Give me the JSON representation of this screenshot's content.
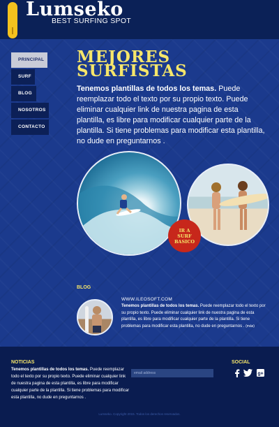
{
  "header": {
    "logo_title": "Lumseko",
    "logo_subtitle": "BEST SURFING SPOT"
  },
  "nav": {
    "items": [
      {
        "label": "PRINCIPAL",
        "active": true
      },
      {
        "label": "SURF"
      },
      {
        "label": "BLOG"
      },
      {
        "label": "NOSOTROS"
      },
      {
        "label": "CONTACTO"
      }
    ]
  },
  "hero": {
    "headline_line1": "MEJORES",
    "headline_line2": "SURFISTAS",
    "intro_bold": "Tenemos plantillas de todos los temas.",
    "intro_rest": " Puede reemplazar todo el texto por su propio texto. Puede eliminar cualquier link de nuestra pagina de esta plantilla, es libre para modificar cualquier parte de la plantilla. Si tiene problemas para modificar esta plantilla, no dude en preguntarnos ."
  },
  "badge": {
    "line1": "IR A",
    "line2": "SURF",
    "line3": "BASICO"
  },
  "blog": {
    "title": "BLOG",
    "url": "WWW.ILEOSOFT.COM",
    "text_bold": "Tenemos plantillas de todos los temas.",
    "text_rest": " Puede reemplazar todo el texto por su propio texto. Puede eliminar cualquier link de nuestra pagina de esta plantilla, es libre para modificar cualquier parte de la plantilla. Si tiene problemas para modificar esta plantilla, no dude en preguntarnos .",
    "more_label": "(más)"
  },
  "footer": {
    "noticias_title": "NOTICIAS",
    "noticias_bold": "Tenemos plantillas de todos los temas.",
    "noticias_rest": " Puede reemplazar todo el texto por su propio texto. Puede eliminar cualquier link de nuestra pagina de esta plantilla, es libre para modificar cualquier parte de la plantilla. Si tiene problemas para modificar esta plantilla, no dude en preguntarnos .",
    "email_placeholder": "email address",
    "social_title": "SOCIAL",
    "social_icons": [
      "facebook-icon",
      "twitter-icon",
      "google-plus-icon"
    ],
    "copyright": "Lumseko. Copyright 2015. Todos los derechos reservados."
  },
  "colors": {
    "navy": "#0d2463",
    "accent_yellow": "#f6e66a",
    "badge_red": "#c7271b"
  }
}
